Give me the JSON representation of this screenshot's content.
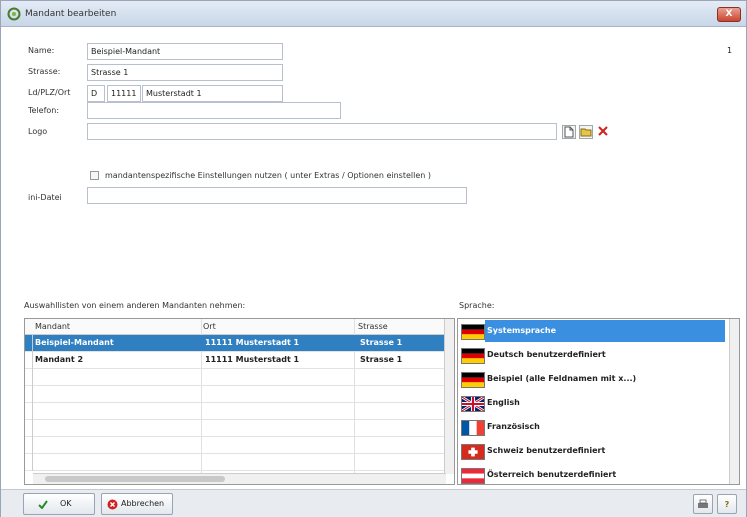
{
  "window": {
    "title": "Mandant bearbeiten",
    "close_label": "X"
  },
  "page_indicator": "1",
  "fields": {
    "name_label": "Name:",
    "name_value": "Beispiel-Mandant",
    "strasse_label": "Strasse:",
    "strasse_value": "Strasse 1",
    "ldplzort_label": "Ld/PLZ/Ort",
    "land_value": "D",
    "plz_value": "11111",
    "ort_value": "Musterstadt 1",
    "telefon_label": "Telefon:",
    "telefon_value": "",
    "logo_label": "Logo",
    "logo_value": "",
    "checkbox_label": "mandantenspezifische Einstellungen nutzen ( unter Extras / Optionen einstellen )",
    "ini_label": "ini-Datei",
    "ini_value": ""
  },
  "grid": {
    "caption": "Auswahllisten von einem anderen Mandanten nehmen:",
    "columns": [
      "Mandant",
      "Ort",
      "Strasse"
    ],
    "rows": [
      {
        "mandant": "Beispiel-Mandant",
        "ort": "11111 Musterstadt 1",
        "strasse": "Strasse 1",
        "selected": true
      },
      {
        "mandant": "Mandant 2",
        "ort": "11111 Musterstadt 1",
        "strasse": "Strasse 1",
        "selected": false
      }
    ]
  },
  "languages": {
    "caption": "Sprache:",
    "items": [
      {
        "label": "Systemsprache",
        "flag": "de",
        "selected": true
      },
      {
        "label": "Deutsch benutzerdefiniert",
        "flag": "de",
        "selected": false
      },
      {
        "label": "Beispiel (alle Feldnamen mit x...)",
        "flag": "de",
        "selected": false
      },
      {
        "label": "English",
        "flag": "uk",
        "selected": false
      },
      {
        "label": "Französisch",
        "flag": "fr",
        "selected": false
      },
      {
        "label": "Schweiz benutzerdefiniert",
        "flag": "ch",
        "selected": false
      },
      {
        "label": "Österreich benutzerdefiniert",
        "flag": "at",
        "selected": false
      }
    ]
  },
  "buttons": {
    "ok": "OK",
    "abbrechen": "Abbrechen",
    "help": "?"
  },
  "colors": {
    "selection": "#2f7fc1",
    "accent_red": "#c9452f"
  }
}
